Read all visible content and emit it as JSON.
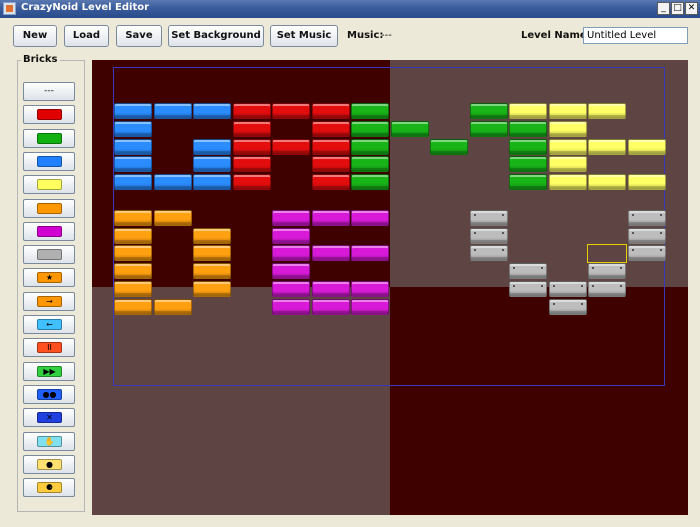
{
  "window": {
    "title": "CrazyNoid Level Editor",
    "minimize": "_",
    "maximize": "□",
    "close": "✕"
  },
  "toolbar": {
    "new_label": "New",
    "load_label": "Load",
    "save_label": "Save",
    "set_background_label": "Set Background",
    "set_music_label": "Set Music",
    "music_label": "Music:",
    "music_value": "---",
    "level_name_label": "Level Name:",
    "level_name_value": "Untitled Level"
  },
  "palette": {
    "title": "Bricks",
    "items": [
      {
        "name": "empty",
        "label": "---"
      },
      {
        "name": "red",
        "color": "#e00000"
      },
      {
        "name": "green",
        "color": "#10b010"
      },
      {
        "name": "blue",
        "color": "#2080ff"
      },
      {
        "name": "yellow",
        "color": "#ffff60"
      },
      {
        "name": "orange",
        "color": "#ff9800"
      },
      {
        "name": "magenta",
        "color": "#d000d0"
      },
      {
        "name": "silver",
        "color": "#b0b0b0"
      },
      {
        "name": "star-powerup",
        "color": "#ff9800",
        "glyph": "★"
      },
      {
        "name": "extend-powerup",
        "color": "#ff9800",
        "glyph": "→"
      },
      {
        "name": "shrink-powerup",
        "color": "#40c0ff",
        "glyph": "←"
      },
      {
        "name": "laser-powerup",
        "color": "#ff5020",
        "glyph": "II"
      },
      {
        "name": "fast-powerup",
        "color": "#30d040",
        "glyph": "▶▶"
      },
      {
        "name": "multiball-powerup",
        "color": "#2060ff",
        "glyph": "●●"
      },
      {
        "name": "slow-powerup",
        "color": "#2040e0",
        "glyph": "✕"
      },
      {
        "name": "catch-powerup",
        "color": "#80e0f0",
        "glyph": "✋"
      },
      {
        "name": "bomb-powerup",
        "color": "#ffe070",
        "glyph": "●"
      },
      {
        "name": "fireball-powerup",
        "color": "#ffcc40",
        "glyph": "⚈"
      }
    ]
  },
  "brick_colors": {
    "B": "#2a8cff",
    "R": "#e30d0d",
    "G": "#18b418",
    "Y": "#ffff66",
    "O": "#ffa010",
    "M": "#d81ad8",
    "S": "#bdbdbd"
  },
  "level_grid": [
    "",
    "",
    "",
    "BBBRRRG..GYYY",
    "B..R.RGG.GGY..",
    "B.BRRRG.G.GYYY",
    "B.BR.RG...GY..",
    "BBBR.RG...GYYY",
    "",
    "OO..MMM..S...S",
    "O.O.M....S...S",
    "O.O.MMM..S...S",
    "O.O.M.....S.S",
    "O.O.MMM...SSS",
    "OO..MMM....S"
  ]
}
